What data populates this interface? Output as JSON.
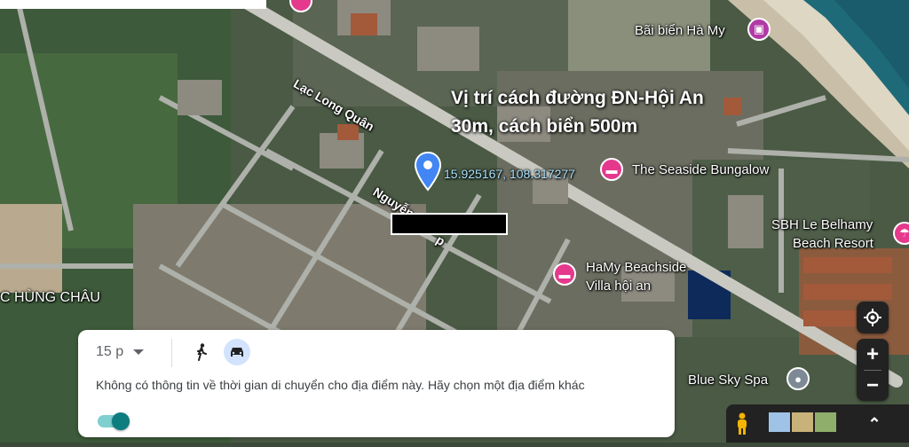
{
  "map": {
    "annotation_line1": "Vị trí cách đường ĐN-Hội An",
    "annotation_line2": "30m, cách biển 500m",
    "coordinates": "15.925167, 108.317277",
    "streets": {
      "lac_long_quan": "Lạc Long Quân",
      "nguyen_partial_1": "Nguyễn",
      "nguyen_partial_2": "p"
    },
    "places": {
      "bai_bien": "Bãi biển Hà My",
      "seaside": "The Seaside Bungalow",
      "sbh_line1": "SBH Le Belhamy",
      "sbh_line2": "Beach Resort",
      "hamy_line1": "HaMy Beachside",
      "hamy_line2": "Villa hội an",
      "bluesky": "Blue Sky Spa",
      "area": "C HÙNG CHÂU"
    },
    "colors": {
      "poi_pink": "#e4398d",
      "pin_blue": "#4285f4",
      "coordinate_text": "#a9e3ff"
    }
  },
  "travel_card": {
    "time": "15 p",
    "message": "Không có thông tin về thời gian di chuyển cho địa điểm này. Hãy chọn một địa điểm khác",
    "toggle_on": true,
    "modes": [
      "walk-icon",
      "car-icon"
    ],
    "selected_mode": "car-icon"
  },
  "controls": {
    "zoom_in": "+",
    "zoom_out": "−",
    "expand": "⌃"
  }
}
